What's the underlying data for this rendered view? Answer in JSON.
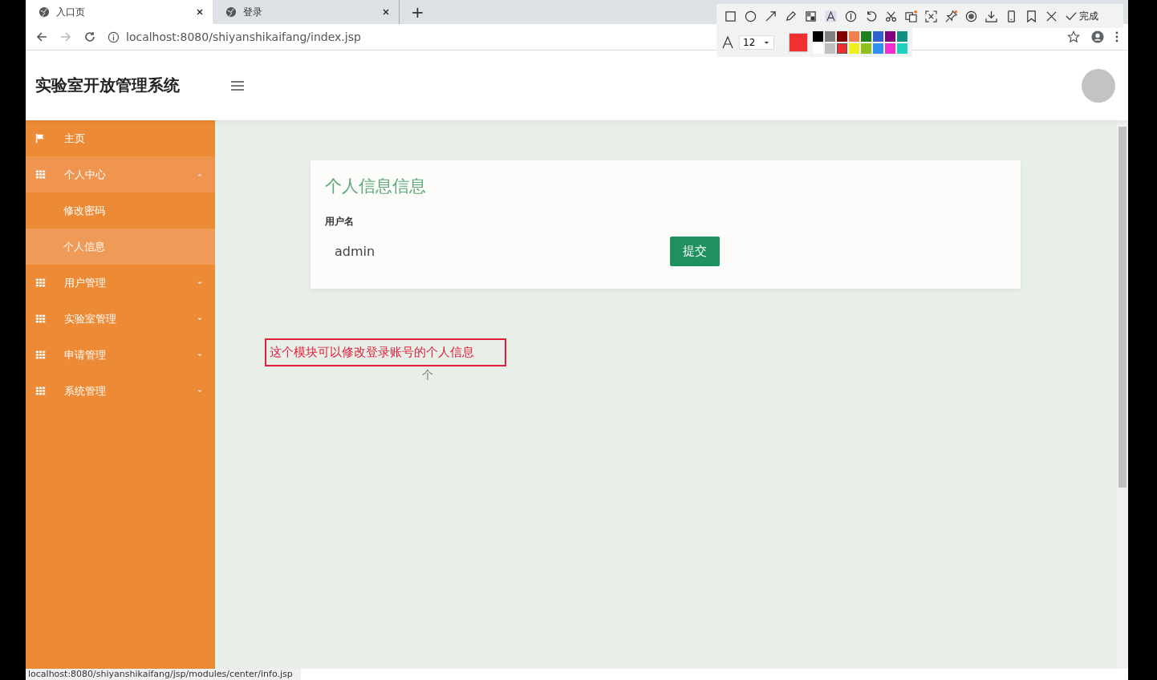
{
  "browser": {
    "tabs": [
      {
        "label": "入口页",
        "selected": true
      },
      {
        "label": "登录",
        "selected": false
      }
    ],
    "new_tab": "+",
    "address": "localhost:8080/shiyanshikaifang/index.jsp"
  },
  "annotation_toolbar": {
    "done": "完成",
    "font_size": "12",
    "palette": [
      {
        "color": "#000000",
        "selected": false
      },
      {
        "color": "#808080",
        "selected": false
      },
      {
        "color": "#800000",
        "selected": false
      },
      {
        "color": "#f08050",
        "selected": false
      },
      {
        "color": "#208020",
        "selected": false
      },
      {
        "color": "#3060d0",
        "selected": false
      },
      {
        "color": "#800080",
        "selected": false
      },
      {
        "color": "#109080",
        "selected": false
      },
      {
        "color": "#ffffff",
        "selected": false
      },
      {
        "color": "#c0c0c0",
        "selected": false
      },
      {
        "color": "#f03030",
        "selected": true
      },
      {
        "color": "#f0f020",
        "selected": false
      },
      {
        "color": "#90c020",
        "selected": false
      },
      {
        "color": "#3090f0",
        "selected": false
      },
      {
        "color": "#f030d0",
        "selected": false
      },
      {
        "color": "#20d0c0",
        "selected": false
      }
    ]
  },
  "app": {
    "title": "实验室开放管理系统",
    "sidebar": [
      {
        "label": "主页",
        "kind": "flag",
        "selected": false
      },
      {
        "label": "个人中心",
        "kind": "group",
        "expanded": true,
        "selected": false,
        "children": [
          {
            "label": "修改密码",
            "selected": false
          },
          {
            "label": "个人信息",
            "selected": true
          }
        ]
      },
      {
        "label": "用户管理",
        "kind": "group",
        "expanded": false,
        "selected": false
      },
      {
        "label": "实验室管理",
        "kind": "group",
        "expanded": false,
        "selected": false
      },
      {
        "label": "申请管理",
        "kind": "group",
        "expanded": false,
        "selected": false
      },
      {
        "label": "系统管理",
        "kind": "group",
        "expanded": false,
        "selected": false
      }
    ],
    "card": {
      "title": "个人信息信息",
      "field_label": "用户名",
      "field_value": "admin",
      "submit": "提交"
    }
  },
  "annotation": {
    "text": "这个模块可以修改登录账号的个人信息",
    "stray_mark": "个"
  },
  "status_url": "localhost:8080/shiyanshikaifang/jsp/modules/center/info.jsp"
}
